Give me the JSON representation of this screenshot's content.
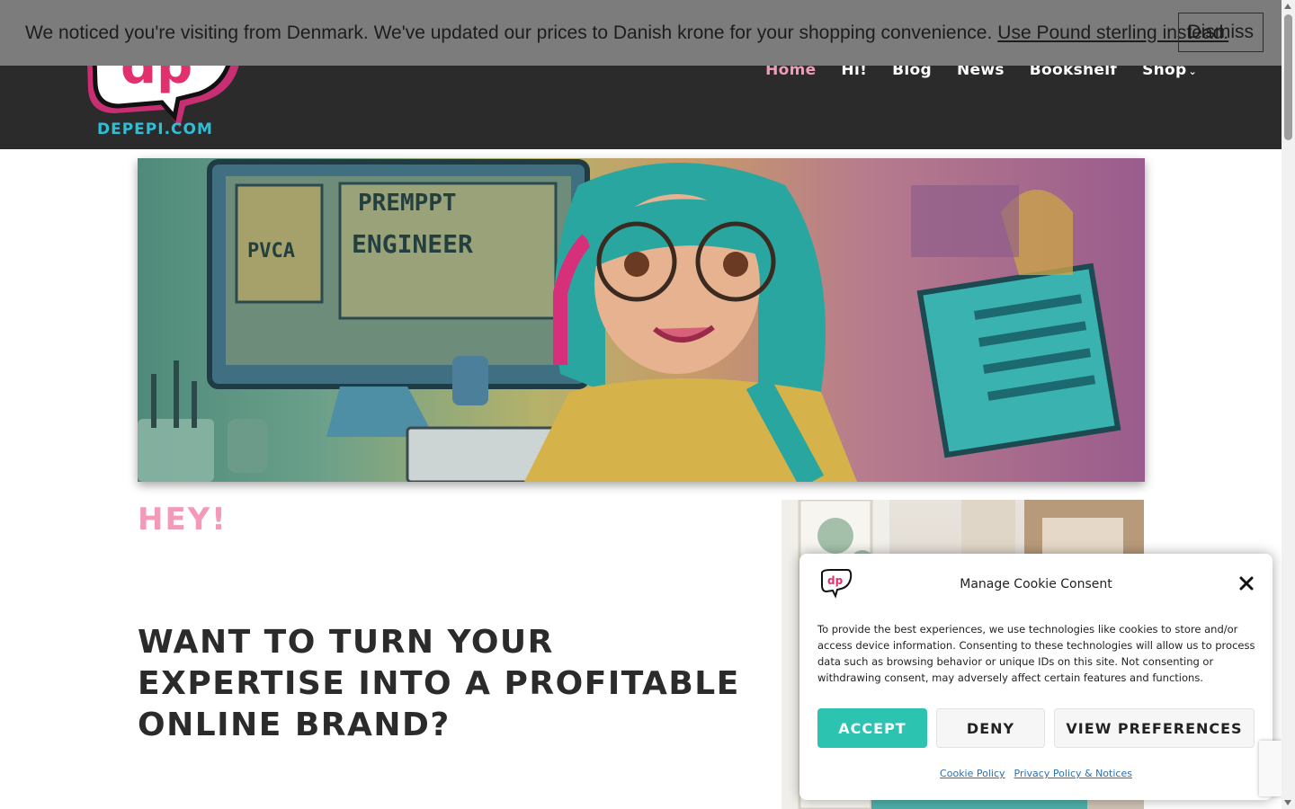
{
  "notice": {
    "text": "We noticed you're visiting from Denmark. We've updated our prices to Danish krone for your shopping convenience.",
    "link": "Use Pound sterling instead.",
    "dismiss": "Dismiss"
  },
  "header": {
    "logo_text": "DEPEPI.COM",
    "logo_letters": "dp",
    "nav": [
      {
        "label": "Home",
        "active": true
      },
      {
        "label": "Hi!"
      },
      {
        "label": "Blog"
      },
      {
        "label": "News"
      },
      {
        "label": "Bookshelf"
      },
      {
        "label": "Shop",
        "dropdown": true
      }
    ],
    "dropdown_glyph": "⌄"
  },
  "hero": {
    "screen_text_1": "PREMPPT",
    "screen_text_2": "ENGINEER",
    "screen_text_3": "PVCA"
  },
  "content": {
    "hey": "HEY!",
    "headline_line1": "WANT TO TURN YOUR",
    "headline_line2": "EXPERTISE INTO A PROFITABLE",
    "headline_line3": "ONLINE BRAND?"
  },
  "cookie": {
    "title": "Manage Cookie Consent",
    "logo_letters": "dp",
    "body": "To provide the best experiences, we use technologies like cookies to store and/or access device information. Consenting to these technologies will allow us to process data such as browsing behavior or unique IDs on this site. Not consenting or withdrawing consent, may adversely affect certain features and functions.",
    "accept": "ACCEPT",
    "deny": "DENY",
    "preferences": "VIEW PREFERENCES",
    "link_cookie_policy": "Cookie Policy",
    "link_privacy": "Privacy Policy & Notices"
  },
  "colors": {
    "header_bg": "#2b2b2b",
    "accent_pink": "#f29ab8",
    "accent_teal": "#2cc3b1",
    "notice_bg": "#7c7c7c"
  }
}
